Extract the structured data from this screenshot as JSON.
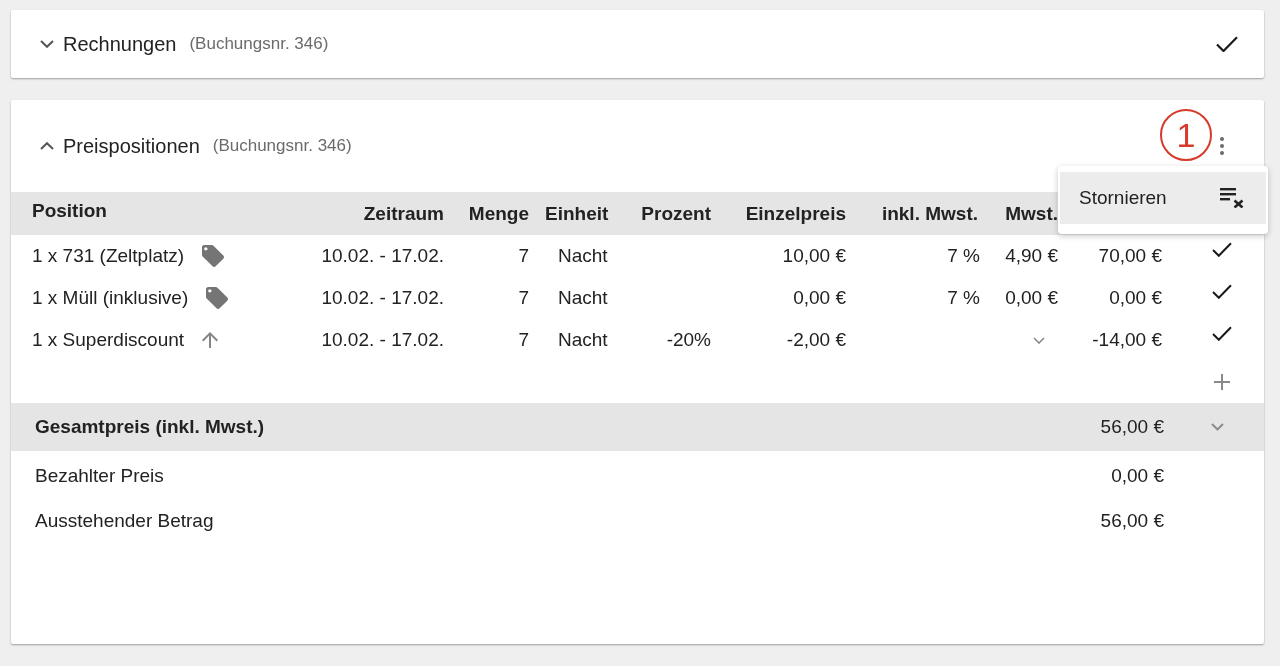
{
  "panels": [
    {
      "title": "Rechnungen",
      "reference": "(Buchungsnr. 346)",
      "expanded": false,
      "completed": true
    },
    {
      "title": "Preispositionen",
      "reference": "(Buchungsnr. 346)",
      "expanded": true,
      "completed": false,
      "annotation": "1",
      "menu": {
        "open": true,
        "items": [
          {
            "label": "Stornieren",
            "selected": true
          }
        ]
      },
      "table": {
        "columns": [
          "Position",
          "Zeitraum",
          "Menge",
          "Einheit",
          "Prozent",
          "Einzelpreis",
          "inkl. Mwst.",
          "Mwst."
        ],
        "rows": [
          {
            "kind": "item",
            "position": "1 x 731 (Zeltplatz)",
            "period": "10.02. - 17.02.",
            "quantity": "7",
            "unit": "Nacht",
            "unit_price": "10,00 €",
            "vat_rate": "7 %",
            "vat": "4,90 €",
            "column_9": "70,00 €",
            "confirmed": true
          },
          {
            "kind": "item",
            "position": "1 x Müll (inklusive)",
            "period": "10.02. - 17.02.",
            "quantity": "7",
            "unit": "Nacht",
            "unit_price": "0,00 €",
            "vat_rate": "7 %",
            "vat": "0,00 €",
            "column_9": "0,00 €",
            "confirmed": true
          },
          {
            "kind": "discount",
            "position": "1 x Superdiscount",
            "period": "10.02. - 17.02.",
            "quantity": "7",
            "unit": "Nacht",
            "percent": "-20%",
            "unit_price": "-2,00 €",
            "column_9": "-14,00 €",
            "confirmed": true
          }
        ]
      },
      "total": {
        "label": "Gesamtpreis (inkl. Mwst.)",
        "value": "56,00 €",
        "expanded": false
      },
      "summary": [
        {
          "label": "Bezahlter Preis",
          "value": "0,00 €"
        },
        {
          "label": "Ausstehender Betrag",
          "value": "56,00 €"
        }
      ]
    }
  ]
}
